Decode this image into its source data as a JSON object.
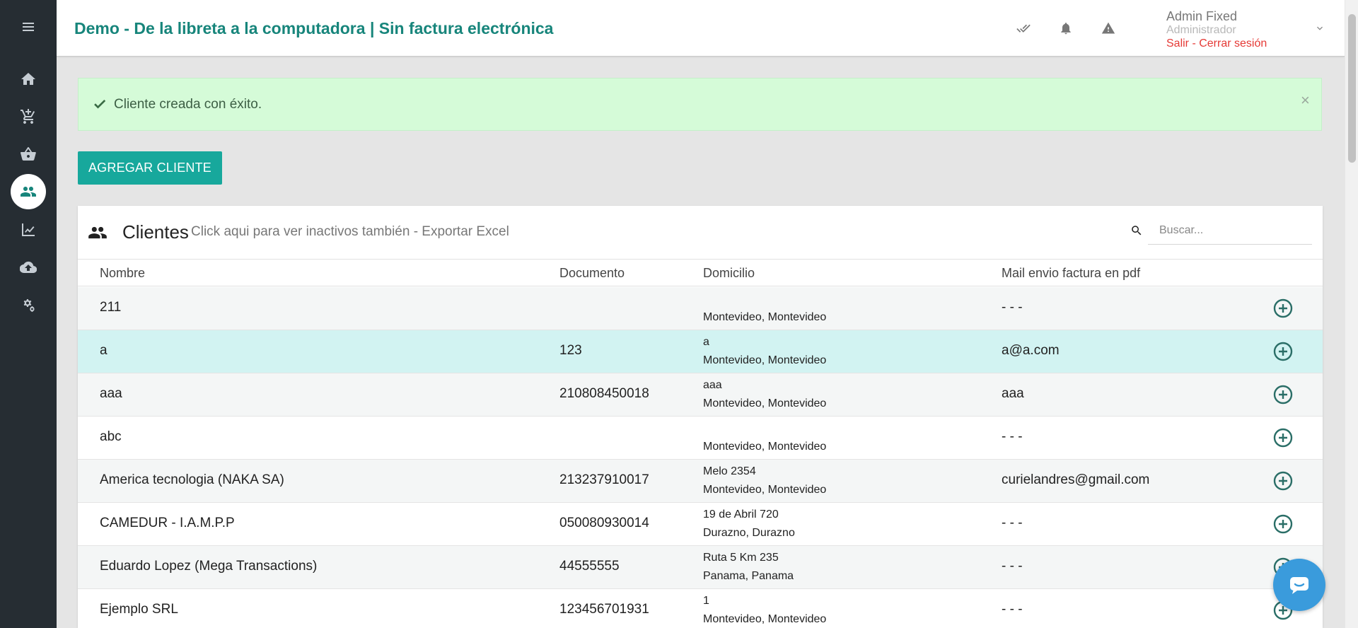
{
  "header": {
    "title": "Demo - De la libreta a la computadora | Sin factura electrónica",
    "user_name": "Admin Fixed",
    "user_role": "Administrador",
    "logout": "Salir - Cerrar sesión"
  },
  "sidebar": {
    "items": [
      {
        "name": "menu-icon"
      },
      {
        "name": "home-icon"
      },
      {
        "name": "cart-add-icon"
      },
      {
        "name": "basket-icon"
      },
      {
        "name": "clients-icon",
        "active": true
      },
      {
        "name": "chart-line-icon"
      },
      {
        "name": "cloud-upload-icon"
      },
      {
        "name": "settings-icon"
      }
    ]
  },
  "alert": {
    "text": "Cliente creada con éxito.",
    "close": "×"
  },
  "actions": {
    "add_client": "AGREGAR CLIENTE"
  },
  "card": {
    "title": "Clientes",
    "subtitle": "Click aqui para ver inactivos también - Exportar Excel",
    "search_placeholder": "Buscar..."
  },
  "table": {
    "columns": [
      "Nombre",
      "Documento",
      "Domicilio",
      "Mail envio factura en pdf"
    ],
    "rows": [
      {
        "name": "211",
        "doc": "",
        "addr1": "",
        "addr2": "Montevideo, Montevideo",
        "mail": "- - -"
      },
      {
        "name": "a",
        "doc": "123",
        "addr1": "a",
        "addr2": "Montevideo, Montevideo",
        "mail": "a@a.com"
      },
      {
        "name": "aaa",
        "doc": "210808450018",
        "addr1": "aaa",
        "addr2": "Montevideo, Montevideo",
        "mail": "aaa"
      },
      {
        "name": "abc",
        "doc": "",
        "addr1": "",
        "addr2": "Montevideo, Montevideo",
        "mail": "- - -"
      },
      {
        "name": "America tecnologia (NAKA SA)",
        "doc": "213237910017",
        "addr1": "Melo 2354",
        "addr2": "Montevideo, Montevideo",
        "mail": "curielandres@gmail.com"
      },
      {
        "name": "CAMEDUR - I.A.M.P.P",
        "doc": "050080930014",
        "addr1": "19 de Abril 720",
        "addr2": "Durazno, Durazno",
        "mail": "- - -"
      },
      {
        "name": "Eduardo Lopez (Mega Transactions)",
        "doc": "44555555",
        "addr1": "Ruta 5 Km 235",
        "addr2": "Panama, Panama",
        "mail": "- - -"
      },
      {
        "name": "Ejemplo SRL",
        "doc": "123456701931",
        "addr1": "1",
        "addr2": "Montevideo, Montevideo",
        "mail": "- - -"
      }
    ]
  },
  "colors": {
    "accent": "#17857b",
    "button": "#17a89c",
    "sidebar": "#262d33",
    "alert_bg": "#d5fbd8",
    "row_highlight": "#d2f3f2",
    "logout": "#e53935"
  }
}
